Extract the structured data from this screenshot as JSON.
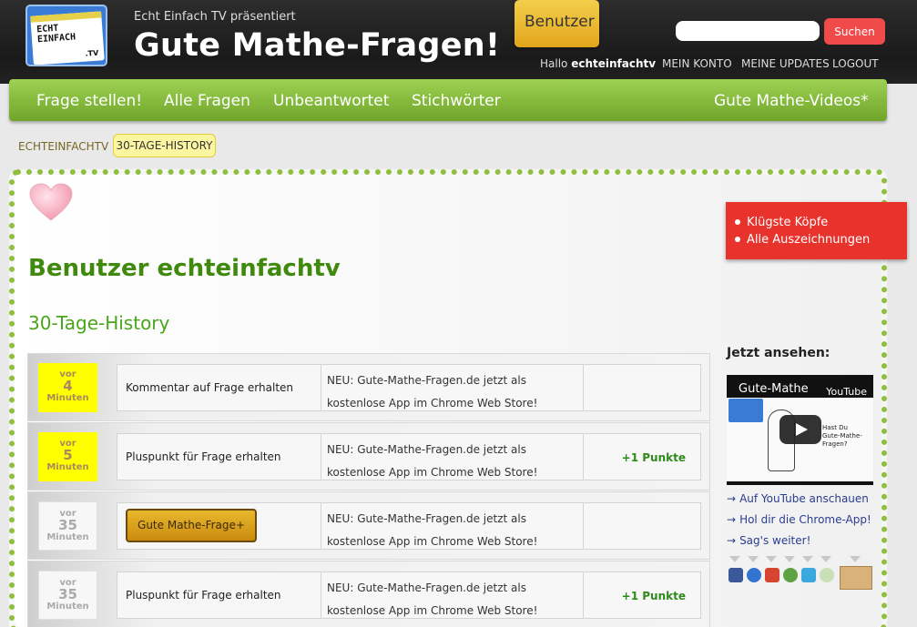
{
  "header": {
    "logo_text_line1": "ECHT",
    "logo_text_line2": "EINFACH",
    "logo_tv": ".TV",
    "presents": "Echt Einfach TV präsentiert",
    "title": "Gute Mathe-Fragen!",
    "search_placeholder": "",
    "search_button": "Suchen",
    "greeting": "Hallo",
    "username": "echteinfachtv",
    "links": [
      "MEIN KONTO",
      "MEINE UPDATES",
      "LOGOUT"
    ]
  },
  "nav": {
    "items": [
      "Frage stellen!",
      "Alle Fragen",
      "Unbeantwortet",
      "Stichwörter",
      "Benutzer",
      "Gute Mathe-Videos*"
    ],
    "active": "Benutzer"
  },
  "breadcrumb": {
    "items": [
      "ECHTEINFACHTV",
      "30-TAGE-HISTORY"
    ]
  },
  "main": {
    "user_heading": "Benutzer echteinfachtv",
    "history_heading": "30-Tage-History",
    "rows": [
      {
        "vor": "vor",
        "num": "4",
        "unit": "Minuten",
        "style": "yellow",
        "action": "Kommentar auf Frage erhalten",
        "news": "NEU: Gute-Mathe-Fragen.de jetzt als kostenlose App im Chrome Web Store!",
        "points": ""
      },
      {
        "vor": "vor",
        "num": "5",
        "unit": "Minuten",
        "style": "yellow",
        "action": "Pluspunkt für Frage erhalten",
        "news": "NEU: Gute-Mathe-Fragen.de jetzt als kostenlose App im Chrome Web Store!",
        "points": "+1 Punkte"
      },
      {
        "vor": "vor",
        "num": "35",
        "unit": "Minuten",
        "style": "grey",
        "action": "Gute Mathe-Frage+",
        "news": "NEU: Gute-Mathe-Fragen.de jetzt als kostenlose App im Chrome Web Store!",
        "points": ""
      },
      {
        "vor": "vor",
        "num": "35",
        "unit": "Minuten",
        "style": "grey",
        "action": "Pluspunkt für Frage erhalten",
        "news": "NEU: Gute-Mathe-Fragen.de jetzt als kostenlose App im Chrome Web Store!",
        "points": "+1 Punkte"
      }
    ]
  },
  "sidebar": {
    "ribbon_items": [
      "Klügste Köpfe",
      "Alle Auszeichnungen"
    ],
    "watch_heading": "Jetzt ansehen:",
    "video_title": "Gute-Mathe",
    "video_brand": "YouTube",
    "video_caption": "Hast Du\nGute-Mathe-Fragen?",
    "links": [
      "Auf YouTube anschauen",
      "Hol dir die Chrome-App!",
      "Sag's weiter!"
    ],
    "share_icons": [
      "facebook-icon",
      "delicious-icon",
      "google-plus-icon",
      "myspace-icon",
      "twitter-icon",
      "email-icon"
    ]
  },
  "colors": {
    "nav_green": "#8cc544",
    "active_orange": "#e8ae22",
    "heading_green": "#3f8a0c",
    "ribbon_red": "#e8322c",
    "search_red": "#f04a4a",
    "badge_yellow": "#ffff00"
  }
}
